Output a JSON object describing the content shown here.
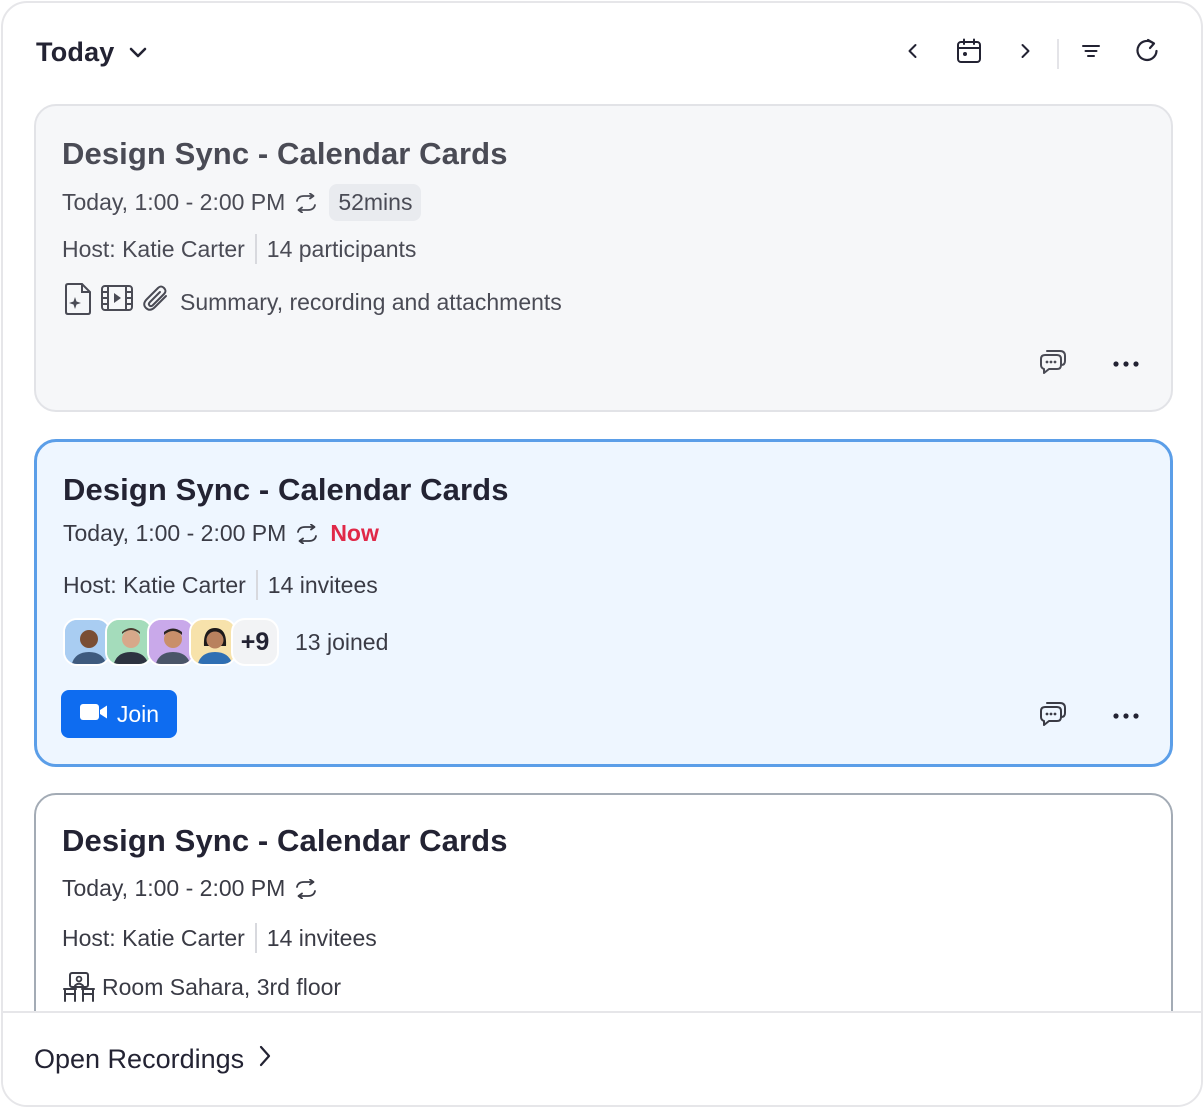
{
  "header": {
    "date_label": "Today",
    "icons": [
      "chevron-down-icon",
      "chevron-left-icon",
      "calendar-icon",
      "chevron-right-icon",
      "filter-icon",
      "refresh-icon"
    ]
  },
  "cards": [
    {
      "title": "Design Sync - Calendar Cards",
      "time": "Today, 1:00 - 2:00 PM",
      "duration": "52mins",
      "host": "Host: Katie Carter",
      "count": "14 participants",
      "assets": "Summary, recording and attachments"
    },
    {
      "title": "Design Sync - Calendar Cards",
      "time": "Today, 1:00 - 2:00 PM",
      "status": "Now",
      "host": "Host: Katie Carter",
      "count": "14 invitees",
      "more_avatars": "+9",
      "joined": "13 joined",
      "join_label": "Join"
    },
    {
      "title": "Design Sync - Calendar Cards",
      "time": "Today, 1:00 - 2:00 PM",
      "host": "Host: Katie Carter",
      "count": "14 invitees",
      "room": "Room Sahara, 3rd floor"
    }
  ],
  "footer": {
    "link_label": "Open Recordings"
  },
  "colors": {
    "accent": "#0e6cf0",
    "now": "#e02848",
    "active_border": "#5b9ee8",
    "active_bg": "#eef6ff"
  }
}
